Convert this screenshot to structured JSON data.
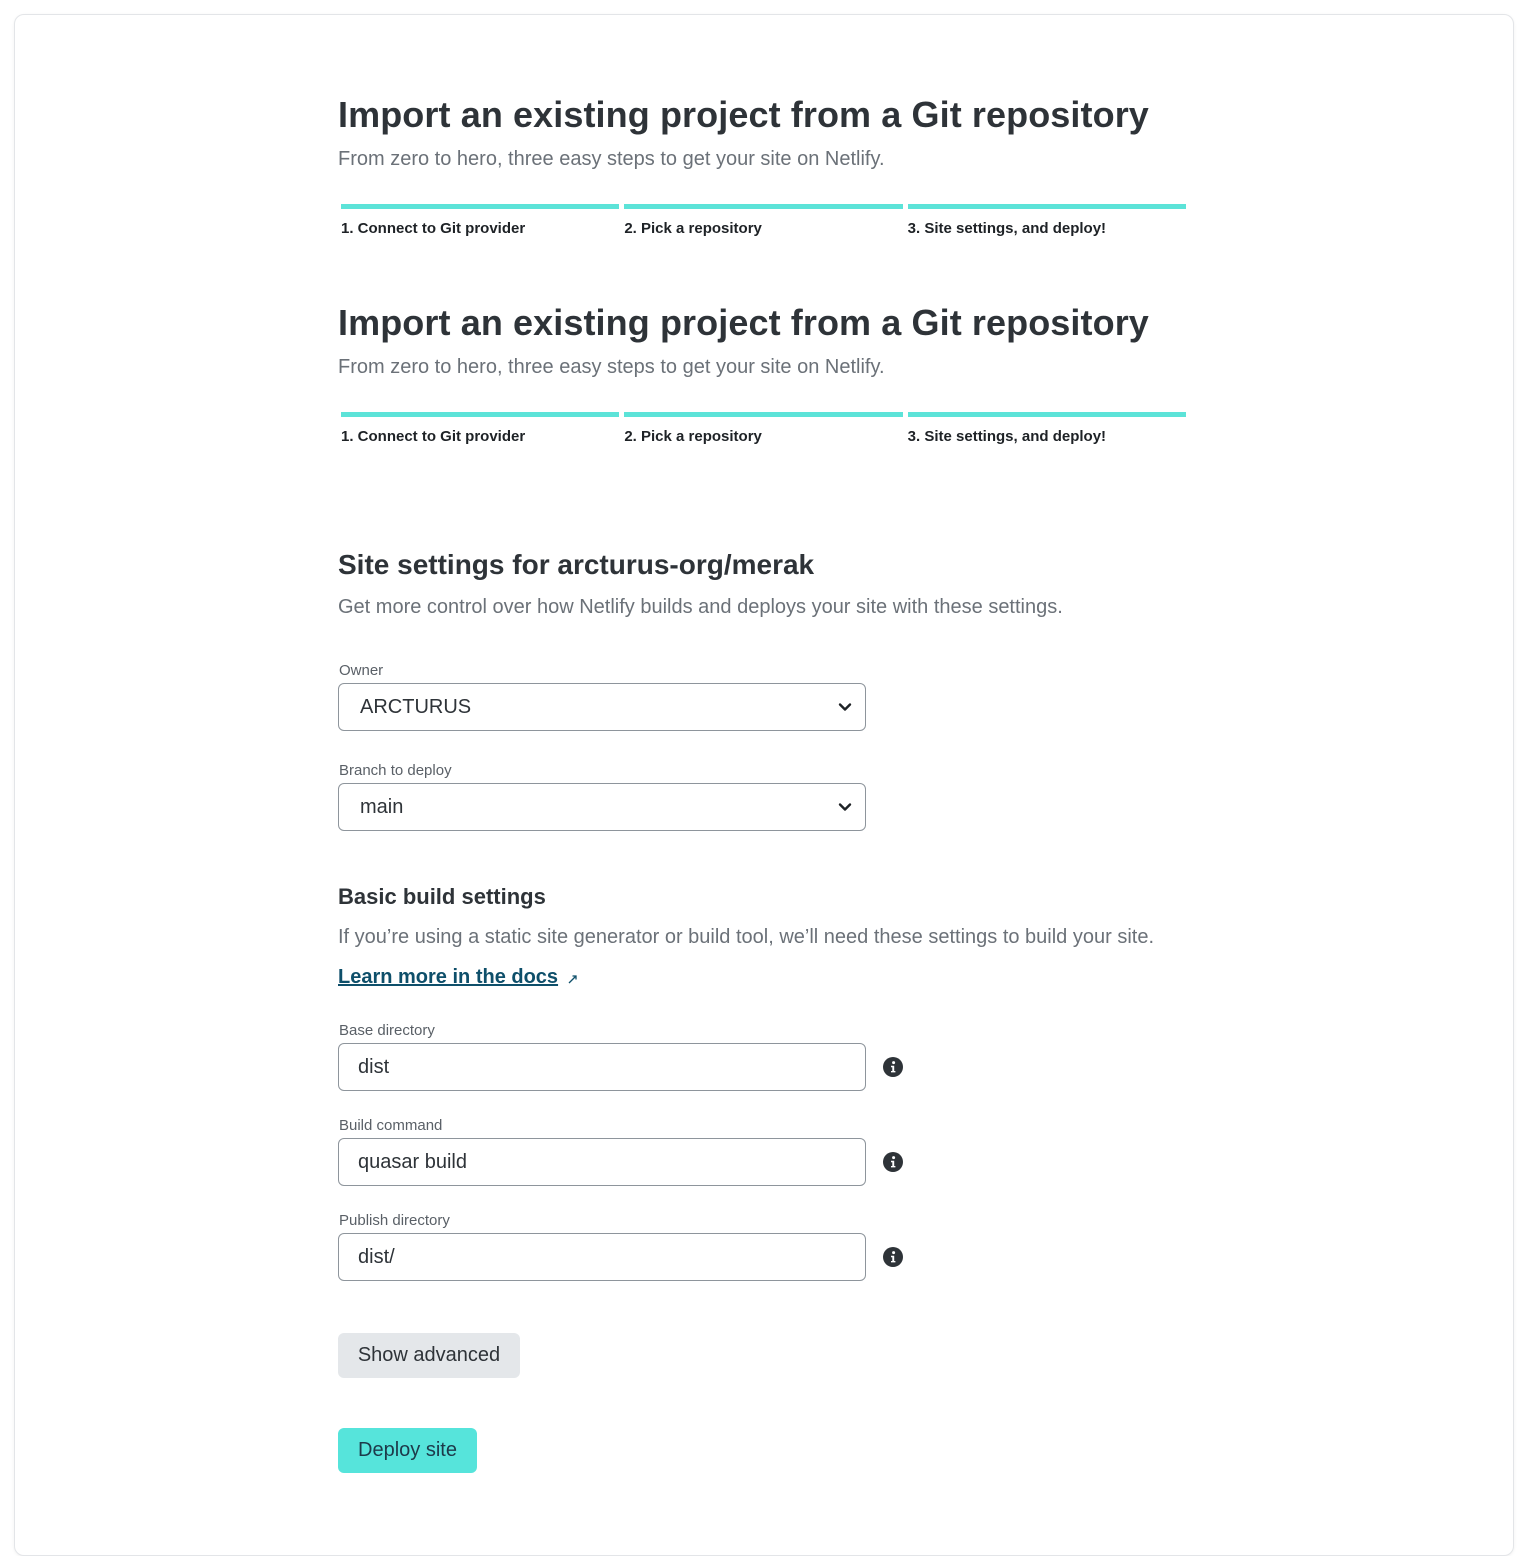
{
  "header_block_1": {
    "title": "Import an existing project from a Git repository",
    "subtitle": "From zero to hero, three easy steps to get your site on Netlify."
  },
  "header_block_2": {
    "title": "Import an existing project from a Git repository",
    "subtitle": "From zero to hero, three easy steps to get your site on Netlify."
  },
  "steps": [
    {
      "label": "1. Connect to Git provider"
    },
    {
      "label": "2. Pick a repository"
    },
    {
      "label": "3. Site settings, and deploy!"
    }
  ],
  "site_settings": {
    "title": "Site settings for arcturus-org/merak",
    "description": "Get more control over how Netlify builds and deploys your site with these settings.",
    "owner_label": "Owner",
    "owner_value": "ARCTURUS",
    "branch_label": "Branch to deploy",
    "branch_value": "main"
  },
  "build_settings": {
    "title": "Basic build settings",
    "description": "If you’re using a static site generator or build tool, we’ll need these settings to build your site.",
    "docs_link": "Learn more in the docs",
    "base_dir_label": "Base directory",
    "base_dir_value": "dist",
    "build_cmd_label": "Build command",
    "build_cmd_value": "quasar build",
    "publish_dir_label": "Publish directory",
    "publish_dir_value": "dist/"
  },
  "actions": {
    "show_advanced": "Show advanced",
    "deploy": "Deploy site"
  },
  "icons": {
    "select_arrow": "chevron-down-icon",
    "info": "info-icon",
    "external": "external-link-icon"
  },
  "colors": {
    "accent": "#5ce3d8",
    "primary_button": "#56e4db",
    "link": "#0e4f6a"
  }
}
